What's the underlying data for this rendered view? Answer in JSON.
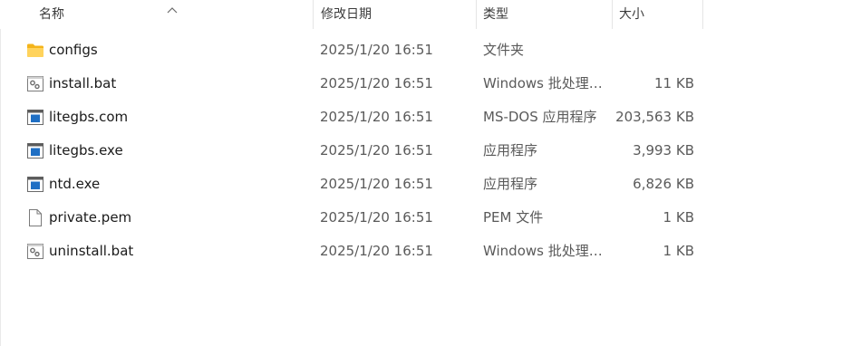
{
  "columns": {
    "name": "名称",
    "date": "修改日期",
    "type": "类型",
    "size": "大小"
  },
  "files": [
    {
      "name": "configs",
      "date": "2025/1/20 16:51",
      "type": "文件夹",
      "size": "",
      "icon": "folder-icon"
    },
    {
      "name": "install.bat",
      "date": "2025/1/20 16:51",
      "type": "Windows 批处理…",
      "size": "11 KB",
      "icon": "batch-file-icon"
    },
    {
      "name": "litegbs.com",
      "date": "2025/1/20 16:51",
      "type": "MS-DOS 应用程序",
      "size": "203,563 KB",
      "icon": "application-icon"
    },
    {
      "name": "litegbs.exe",
      "date": "2025/1/20 16:51",
      "type": "应用程序",
      "size": "3,993 KB",
      "icon": "application-icon"
    },
    {
      "name": "ntd.exe",
      "date": "2025/1/20 16:51",
      "type": "应用程序",
      "size": "6,826 KB",
      "icon": "application-icon"
    },
    {
      "name": "private.pem",
      "date": "2025/1/20 16:51",
      "type": "PEM 文件",
      "size": "1 KB",
      "icon": "document-icon"
    },
    {
      "name": "uninstall.bat",
      "date": "2025/1/20 16:51",
      "type": "Windows 批处理…",
      "size": "1 KB",
      "icon": "batch-file-icon"
    }
  ],
  "colors": {
    "folder": "#f8c649",
    "app_blue": "#1f6fc4",
    "header_text": "#3b3b3b",
    "muted_text": "#5a5a5a"
  }
}
